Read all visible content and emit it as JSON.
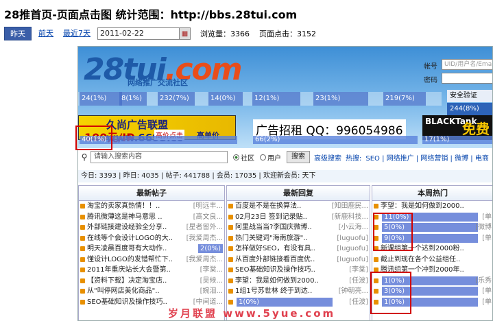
{
  "title": "28推首页-页面点击图 统计范围：http://bbs.28tui.com",
  "toolbar": {
    "today": "昨天",
    "prev": "前天",
    "last7": "最近7天",
    "date": "2011-02-22",
    "pv_label": "浏览量：",
    "pv": "3366",
    "clicks_label": "页面点击：",
    "clicks": "3152"
  },
  "site": {
    "logo_a": "28tui",
    "logo_b": ".com",
    "logo_sub": "网络推广交流社区",
    "login_user_label": "帐号",
    "login_user_placeholder": "UID/用户名/Email",
    "login_pass_label": "密码",
    "safe_label": "安全验证",
    "safe_click": "244(8%)",
    "nav_clicks": [
      "24(1%)",
      "8(1%)",
      "232(7%)",
      "14(0%)",
      "12(1%)",
      "23(1%)",
      "219(7%)"
    ],
    "ad1_line1": "久尚广告联盟 www.6693.cc",
    "ad1_line2": "100元/IP",
    "ad1_line3": "高价点击",
    "ad1_line4": "高单价",
    "ad2": "广告招租 QQ：996054986",
    "ad3_a": "BLACKTank",
    "ad3_b": "免费",
    "ad_clicks": [
      "40(1%)",
      "66(2%)",
      "17(1%)"
    ],
    "search_placeholder": "请输入搜索内容",
    "radio_1": "社区",
    "radio_2": "用户",
    "search_btn": "搜索",
    "adv_search": "高级搜索",
    "hot_label": "热搜:",
    "hot_links": "SEO | 网络推广 | 网络营销 | 微博 | 电商",
    "counts": "今日: 3393 | 昨日: 4035 | 帖子: 441788 | 会员: 17035 | 欢迎新会员: 天下"
  },
  "columns": [
    {
      "head": "最新帖子",
      "rows": [
        {
          "t": "淘宝的卖家真热情！！..",
          "a": "[明远丰..."
        },
        {
          "t": "腾讯微薄这是神马意思 ..",
          "a": "[高文良..."
        },
        {
          "t": "外部链接建设经验全分享..",
          "a": "[星者留外..."
        },
        {
          "t": "在线等个会设计LOGO的大..",
          "a": "[我爱周杰..."
        },
        {
          "t": "明天凌晨百度哥有大动作..",
          "a": "2(0%)"
        },
        {
          "t": "懂设计LOGO的发错帮忙下..",
          "a": "[我爱周杰..."
        },
        {
          "t": "2011年重庆站长大会暨第..",
          "a": "[李棠..."
        },
        {
          "t": "【资料下载】决定淘宝店..",
          "a": "[吴候..."
        },
        {
          "t": "从\"叫停网店美化商品\"..",
          "a": "[婉泪..."
        },
        {
          "t": "SEO基础知识及操作技巧..",
          "a": "[中间道..."
        }
      ]
    },
    {
      "head": "最新回复",
      "rows": [
        {
          "t": "百度是不是在换算法..",
          "a": "[知田鹿民..."
        },
        {
          "t": "02月23日 签到记录贴..",
          "a": "[新鹿科技..."
        },
        {
          "t": "阿里战当当?李国庆微博..",
          "a": "[小云海..."
        },
        {
          "t": "热门关键词\"海南旅游\"..",
          "a": "[luguofu]"
        },
        {
          "t": "怎样做好SEO，有没有具..",
          "a": "[luguofu]"
        },
        {
          "t": "从百度外部链接看百度优..",
          "a": "[luguofu]"
        },
        {
          "t": "SEO基础知识及操作技巧..",
          "a": "[李棠]"
        },
        {
          "t": "李望：我是如何做到2000..",
          "a": "[任波]"
        },
        {
          "t": "1组1号苏世林 终于到达..",
          "a": "[钟朝亮..."
        },
        {
          "t": "1(0%)",
          "a": "[任波]"
        }
      ]
    },
    {
      "head": "本周热门",
      "rows": [
        {
          "t": "李望：我是如何做到2000..",
          "a": ""
        },
        {
          "t": "11(0%)",
          "a": "[单"
        },
        {
          "t": "5(0%)",
          "a": "[微博"
        },
        {
          "t": "9(0%)",
          "a": "[单"
        },
        {
          "t": "新课组第一个达到2000粉..",
          "a": ""
        },
        {
          "t": "截止到现在各个公益组任..",
          "a": ""
        },
        {
          "t": "腾讯组第一个冲到2000年..",
          "a": ""
        },
        {
          "t": "1(0%)",
          "a": "[乐秀"
        },
        {
          "t": "3(0%)",
          "a": "[单"
        },
        {
          "t": "1(0%)",
          "a": "[单"
        }
      ]
    }
  ],
  "watermark": "岁月联盟 www.5yue.com",
  "colors": {
    "accent": "#3a5ea8",
    "highlight": "#5a6ed2",
    "red": "#d10000"
  }
}
